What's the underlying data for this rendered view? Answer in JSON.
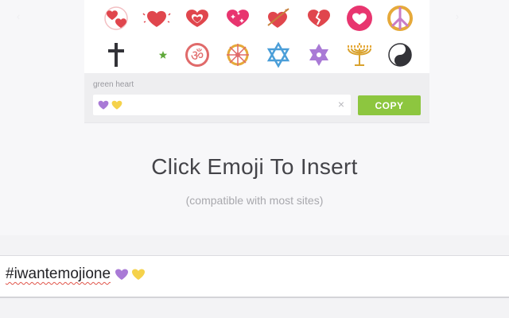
{
  "colors": {
    "accent_green": "#8dc63f",
    "heart_red": "#e0464d",
    "heart_purple": "#a97ad6",
    "heart_yellow": "#f5d24b"
  },
  "emoji_grid": {
    "row1": [
      {
        "name": "revolving-hearts-icon"
      },
      {
        "name": "growing-heart-icon"
      },
      {
        "name": "heart-decoration-icon"
      },
      {
        "name": "sparkling-heart-icon"
      },
      {
        "name": "heart-with-arrow-icon"
      },
      {
        "name": "broken-heart-icon"
      },
      {
        "name": "heart-circle-icon"
      },
      {
        "name": "peace-symbol-icon"
      }
    ],
    "row2": [
      {
        "name": "latin-cross-icon"
      },
      {
        "name": "star-and-crescent-icon"
      },
      {
        "name": "om-symbol-icon"
      },
      {
        "name": "wheel-of-dharma-icon"
      },
      {
        "name": "star-of-david-icon"
      },
      {
        "name": "six-pointed-star-icon"
      },
      {
        "name": "menorah-icon"
      },
      {
        "name": "yin-yang-icon"
      }
    ]
  },
  "preview": {
    "label": "green heart",
    "field_emoji": [
      "purple-heart-icon",
      "yellow-heart-icon"
    ],
    "clear_glyph": "×",
    "copy_label": "COPY"
  },
  "headline": "Click Emoji To Insert",
  "subline": "(compatible with most sites)",
  "input": {
    "hashtag": "#iwantemojione",
    "emoji": [
      "purple-heart-icon",
      "yellow-heart-icon"
    ]
  }
}
